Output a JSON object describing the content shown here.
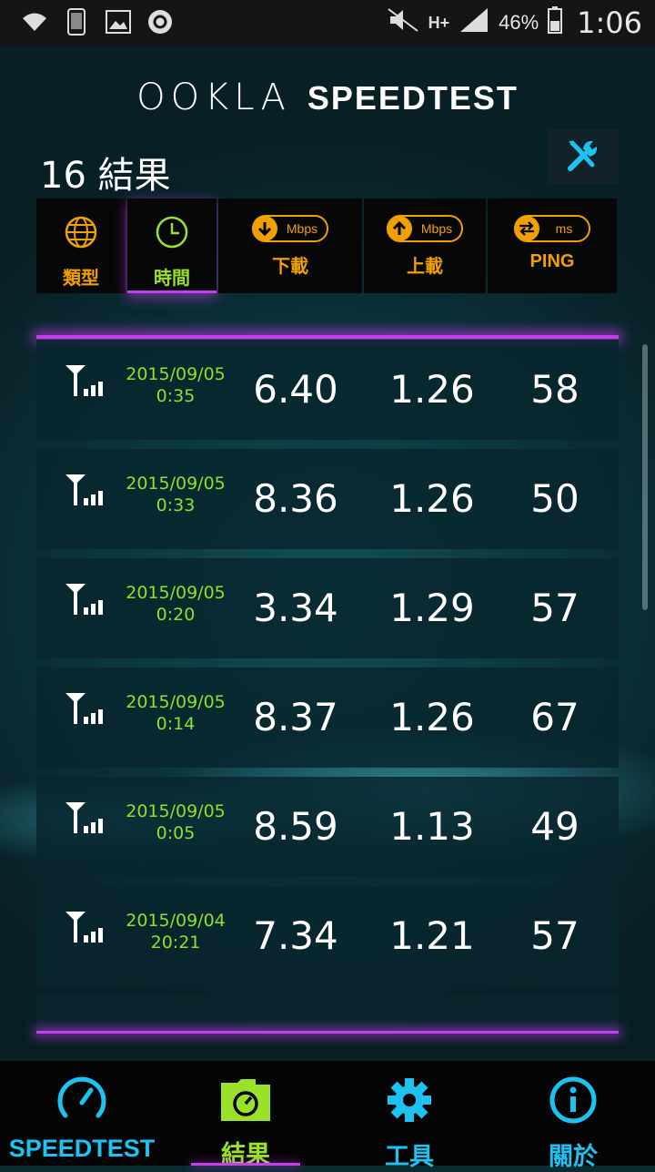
{
  "status_bar": {
    "network": "H+",
    "battery": "46%",
    "time": "1:06"
  },
  "header": {
    "logo_brand": "OOKLA",
    "logo_product": "SPEEDTEST",
    "results_count": "16 結果",
    "tools_icon": "tools-icon"
  },
  "sort_columns": [
    {
      "label": "類型",
      "icon": "globe-icon"
    },
    {
      "label": "時間",
      "icon": "clock-icon",
      "active": true
    },
    {
      "label": "下載",
      "icon": "download-arrow-icon",
      "unit": "Mbps"
    },
    {
      "label": "上載",
      "icon": "upload-arrow-icon",
      "unit": "Mbps"
    },
    {
      "label": "PING",
      "icon": "ping-arrows-icon",
      "unit": "ms"
    }
  ],
  "results": [
    {
      "date": "2015/09/05",
      "time": "0:35",
      "download": "6.40",
      "upload": "1.26",
      "ping": "58"
    },
    {
      "date": "2015/09/05",
      "time": "0:33",
      "download": "8.36",
      "upload": "1.26",
      "ping": "50"
    },
    {
      "date": "2015/09/05",
      "time": "0:20",
      "download": "3.34",
      "upload": "1.29",
      "ping": "57"
    },
    {
      "date": "2015/09/05",
      "time": "0:14",
      "download": "8.37",
      "upload": "1.26",
      "ping": "67"
    },
    {
      "date": "2015/09/05",
      "time": "0:05",
      "download": "8.59",
      "upload": "1.13",
      "ping": "49"
    },
    {
      "date": "2015/09/04",
      "time": "20:21",
      "download": "7.34",
      "upload": "1.21",
      "ping": "57"
    }
  ],
  "bottom_nav": [
    {
      "label": "SPEEDTEST",
      "icon": "speedometer-icon"
    },
    {
      "label": "結果",
      "icon": "results-folder-icon",
      "active": true
    },
    {
      "label": "工具",
      "icon": "gear-icon"
    },
    {
      "label": "關於",
      "icon": "info-icon"
    }
  ],
  "colors": {
    "accent_orange": "#f0a000",
    "accent_green": "#9ae22a",
    "accent_blue": "#1ec2f0",
    "accent_purple": "#c43ef0"
  }
}
